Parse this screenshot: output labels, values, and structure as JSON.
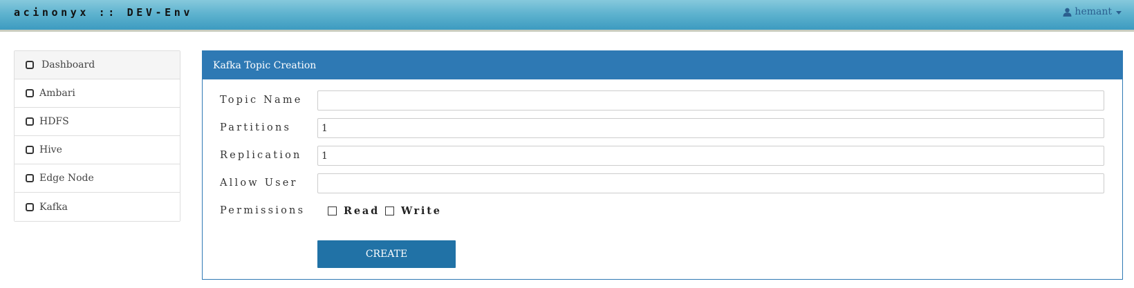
{
  "header": {
    "brand": "acinonyx :: DEV-Env",
    "user_name": "hemant",
    "user_icon": "user-icon"
  },
  "sidebar": {
    "items": [
      {
        "label": "Dashboard",
        "icon": "square-icon",
        "active": true
      },
      {
        "label": "Ambari",
        "icon": "square-icon"
      },
      {
        "label": "HDFS",
        "icon": "square-icon"
      },
      {
        "label": "Hive",
        "icon": "square-icon"
      },
      {
        "label": "Edge Node",
        "icon": "square-icon"
      },
      {
        "label": "Kafka",
        "icon": "square-icon"
      }
    ]
  },
  "panel": {
    "title": "Kafka Topic Creation",
    "fields": {
      "topic_name": {
        "label": "Topic Name",
        "value": ""
      },
      "partitions": {
        "label": "Partitions",
        "value": "1"
      },
      "replication": {
        "label": "Replication",
        "value": "1"
      },
      "allow_user": {
        "label": "Allow User",
        "value": ""
      }
    },
    "permissions": {
      "label": "Permissions",
      "read_label": "Read",
      "read_checked": false,
      "write_label": "Write",
      "write_checked": false
    },
    "create_label": "CREATE"
  },
  "colors": {
    "accent": "#2e79b4",
    "button": "#2172a6",
    "header_top": "#86c9dc",
    "header_bottom": "#3d9bc0"
  }
}
